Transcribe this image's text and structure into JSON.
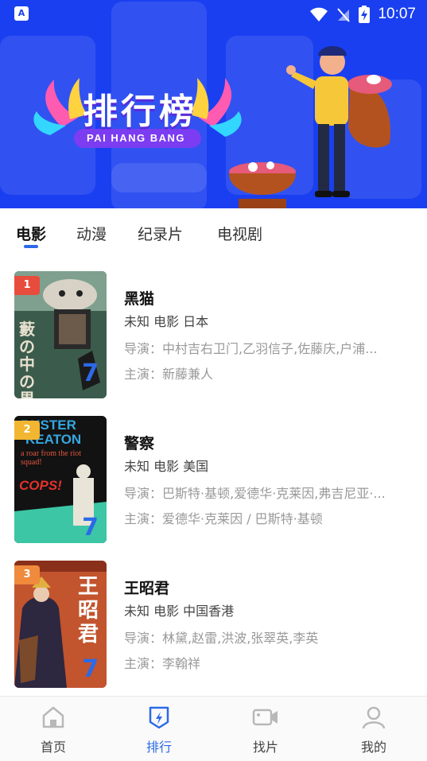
{
  "status_bar": {
    "time": "10:07",
    "left_badge": "A"
  },
  "banner": {
    "title": "排行榜",
    "subtitle": "PAI HANG BANG"
  },
  "tabs": [
    {
      "label": "电影",
      "active": true
    },
    {
      "label": "动漫",
      "active": false
    },
    {
      "label": "纪录片",
      "active": false
    },
    {
      "label": "电视剧",
      "active": false
    }
  ],
  "movies": [
    {
      "rank": "1",
      "rank_color": "#e84c3d",
      "title": "黑猫",
      "meta": "未知  电影  日本",
      "director_label": "导演：",
      "director": "中村吉右卫门,乙羽信子,佐藤庆,户浦...",
      "cast_label": "主演：",
      "cast": "新藤兼人",
      "poster_text": "藪の中の黒猫"
    },
    {
      "rank": "2",
      "rank_color": "#f2b630",
      "title": "警察",
      "meta": "未知  电影  美国",
      "director_label": "导演：",
      "director": "巴斯特·基顿,爱德华·克莱因,弗吉尼亚·...",
      "cast_label": "主演：",
      "cast": "爱德华·克莱因 / 巴斯特·基顿",
      "poster_text_1": "BUSTER",
      "poster_text_2": "KEATON",
      "poster_text_3": "a roar from the riot squad!",
      "poster_text_4": "COPS!"
    },
    {
      "rank": "3",
      "rank_color": "#f08a3c",
      "title": "王昭君",
      "meta": "未知  电影  中国香港",
      "director_label": "导演：",
      "director": "林黛,赵雷,洪波,张翠英,李英",
      "cast_label": "主演：",
      "cast": "李翰祥",
      "poster_text": "王昭君"
    }
  ],
  "bottom_nav": [
    {
      "label": "首页",
      "icon": "home-icon",
      "active": false
    },
    {
      "label": "排行",
      "icon": "ranking-icon",
      "active": true
    },
    {
      "label": "找片",
      "icon": "video-camera-icon",
      "active": false
    },
    {
      "label": "我的",
      "icon": "user-icon",
      "active": false
    }
  ],
  "colors": {
    "banner_blue": "#1a3ff0",
    "accent_blue": "#2b6ae8"
  }
}
